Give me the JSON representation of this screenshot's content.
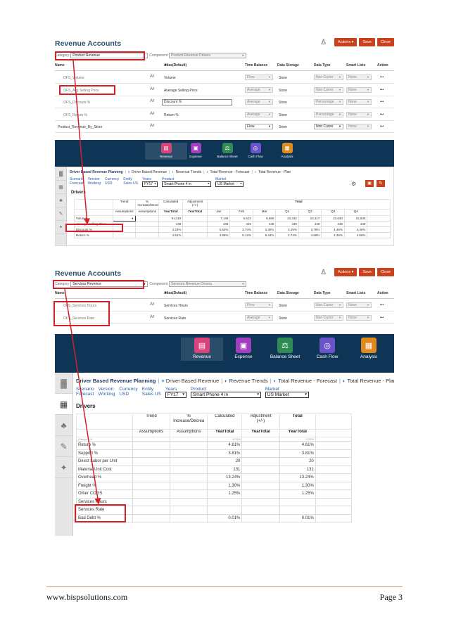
{
  "panel1": {
    "title": "Revenue Accounts",
    "actions_label": "Actions",
    "save_label": "Save",
    "close_label": "Close",
    "category_label": "Category",
    "category_value": "Product Revenue",
    "component_label": "Component",
    "component_value": "Product Revenue Drivers",
    "columns": {
      "name": "Name",
      "alias": "Alias(Default)",
      "time_balance": "Time Balance",
      "data_storage": "Data Storage",
      "data_type": "Data Type",
      "smart_lists": "Smart Lists",
      "action": "Action"
    },
    "rows": [
      {
        "name": "OFS_Volume",
        "alias": "Volume",
        "tb": "Flow",
        "ds": "Store",
        "dt": "Non Currer",
        "sl": "None",
        "act": "•••"
      },
      {
        "name": "OFS_Avg Selling Price",
        "alias": "Average Selling Price",
        "tb": "Average",
        "ds": "Store",
        "dt": "Non Currer",
        "sl": "None",
        "act": "•••"
      },
      {
        "name": "OFS_Discount %",
        "alias": "Discount %",
        "tb": "Average",
        "ds": "Store",
        "dt": "Percentage",
        "sl": "None",
        "act": "•••"
      },
      {
        "name": "OFS_Return %",
        "alias": "Return %",
        "tb": "Average",
        "ds": "Store",
        "dt": "Percentage",
        "sl": "None",
        "act": "•••"
      },
      {
        "name": "Product_Revenue_By_Store",
        "alias": "",
        "tb": "Flow",
        "ds": "Store",
        "dt": "Non Currer",
        "sl": "None",
        "act": "•••"
      }
    ]
  },
  "nav": {
    "items": [
      {
        "label": "Revenue",
        "color": "#d9427a"
      },
      {
        "label": "Expense",
        "color": "#a23fbf"
      },
      {
        "label": "Balance Sheet",
        "color": "#2f8b53"
      },
      {
        "label": "Cash Flow",
        "color": "#6a54c9"
      },
      {
        "label": "Analysis",
        "color": "#e08a1e"
      }
    ]
  },
  "form1": {
    "tab_title": "Driver Based Revenue Planning",
    "tabs": [
      "Driver Based Revenue",
      "Revenue Trends",
      "Total Revenue - Forecast",
      "Total Revenue - Plan"
    ],
    "pov": [
      {
        "label": "Scenario",
        "value": "Forecast"
      },
      {
        "label": "Version",
        "value": "Working"
      },
      {
        "label": "Currency",
        "value": "USD"
      },
      {
        "label": "Entity",
        "value": "Sales US"
      },
      {
        "label": "Years",
        "value": "FY17"
      },
      {
        "label": "Product",
        "value": "Smart Phone 4 in"
      },
      {
        "label": "Market",
        "value": "US Market"
      }
    ],
    "drivers_label": "Drivers",
    "headers": {
      "trend": "Trend",
      "pct": "%\nIncrease/Decreas",
      "calculated": "Calculated",
      "adjustment": "Adjustment\n(+/-)",
      "total": "Total",
      "assumptions": "Assumptions",
      "assumptions2": "Assumptions",
      "yeartotal": "YearTotal",
      "yeartotal2": "YearTotal",
      "months": [
        "Jan",
        "Feb",
        "Mar",
        "Q1",
        "Q2",
        "Q3",
        "Q4"
      ]
    },
    "rows": [
      {
        "label": "Volume",
        "yt": "91,319",
        "jan": "7,149",
        "feb": "6,513",
        "mar": "8,680",
        "q1": "22,342",
        "q2": "23,317",
        "q3": "22,630",
        "q4": "22,530"
      },
      {
        "label": "Average Selling Price",
        "yt": "449",
        "jan": "449",
        "feb": "449",
        "mar": "449",
        "q1": "449",
        "q2": "449",
        "q3": "449",
        "q4": "449"
      },
      {
        "label": "Discount %",
        "yt": "4.23%",
        "jan": "5.63%",
        "feb": "3.74%",
        "mar": "3.30%",
        "q1": "4.25%",
        "q2": "3.75%",
        "q3": "4.46%",
        "q4": "4.46%"
      },
      {
        "label": "Return %",
        "yt": "4.61%",
        "jan": "3.86%",
        "feb": "5.12%",
        "mar": "5.44%",
        "q1": "4.74%",
        "q2": "4.69%",
        "q3": "4.35%",
        "q4": "4.65%"
      }
    ]
  },
  "panel2": {
    "title": "Revenue Accounts",
    "actions_label": "Actions",
    "save_label": "Save",
    "close_label": "Close",
    "category_label": "Category",
    "category_value": "Services Revenue",
    "component_label": "Component",
    "component_value": "Services Revenue Drivers",
    "columns": {
      "name": "Name",
      "alias": "Alias(Default)",
      "time_balance": "Time Balance",
      "data_storage": "Data Storage",
      "data_type": "Data Type",
      "smart_lists": "Smart Lists",
      "action": "Action"
    },
    "rows": [
      {
        "name": "OFS_Services Hours",
        "alias": "Services Hours",
        "tb": "Flow",
        "ds": "Store",
        "dt": "Non Currer",
        "sl": "None",
        "act": "•••"
      },
      {
        "name": "OFS_Services Rate",
        "alias": "Services Rate",
        "tb": "Average",
        "ds": "Store",
        "dt": "Non Currer",
        "sl": "None",
        "act": "•••"
      }
    ]
  },
  "form2": {
    "tab_title": "Driver Based Revenue Planning",
    "tabs": [
      "Driver Based Revenue",
      "Revenue Trends",
      "Total Revenue - Forecast",
      "Total Revenue - Plan"
    ],
    "pov": [
      {
        "label": "Scenario",
        "value": "Forecast"
      },
      {
        "label": "Version",
        "value": "Working"
      },
      {
        "label": "Currency",
        "value": "USD"
      },
      {
        "label": "Entity",
        "value": "Sales US"
      },
      {
        "label": "Years",
        "value": "FY17"
      },
      {
        "label": "Product",
        "value": "Smart Phone 4 in"
      },
      {
        "label": "Market",
        "value": "US Market"
      }
    ],
    "drivers_label": "Drivers",
    "headers": {
      "trend": "Trend",
      "pct": "%\nIncrease/Decrea",
      "calculated": "Calculated",
      "adjustment": "Adjustment\n(+/-)",
      "total": "Total",
      "assumptions": "Assumptions",
      "assumptions2": "Assumptions",
      "yeartotal": "YearTotal",
      "yeartotal2": "YearTotal",
      "yeartotal3": "YearTotal"
    },
    "rows": [
      {
        "label": "Discount %",
        "yt": "4.23%",
        "tot": "4.23%"
      },
      {
        "label": "Return %",
        "yt": "4.61%",
        "tot": "4.61%"
      },
      {
        "label": "Support %",
        "yt": "3.81%",
        "tot": "3.81%"
      },
      {
        "label": "Direct Labor per Unit",
        "yt": "20",
        "tot": "20"
      },
      {
        "label": "Material Unit Cost",
        "yt": "131",
        "tot": "131"
      },
      {
        "label": "Overhead %",
        "yt": "13.24%",
        "tot": "13.24%"
      },
      {
        "label": "Freight %",
        "yt": "1.30%",
        "tot": "1.30%"
      },
      {
        "label": "Other COGS",
        "yt": "1.25%",
        "tot": "1.25%"
      },
      {
        "label": "Services Hours",
        "yt": "",
        "tot": ""
      },
      {
        "label": "Services Rate",
        "yt": "",
        "tot": ""
      },
      {
        "label": "Bad Debt %",
        "yt": "0.01%",
        "tot": "0.01%"
      }
    ]
  },
  "footer": {
    "left": "www.bispsolutions.com",
    "right": "Page 3"
  },
  "colors": {
    "accent_red": "#d1202c",
    "button_orange": "#c8431d",
    "nav_bg": "#0f3556",
    "title_blue": "#2d4f6c"
  }
}
